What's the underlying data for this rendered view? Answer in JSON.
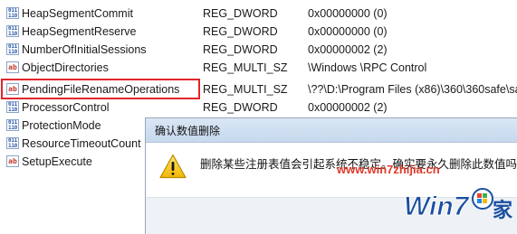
{
  "registry": {
    "rows": [
      {
        "icon": "binary-value-icon",
        "name": "HeapSegmentCommit",
        "type": "REG_DWORD",
        "data": "0x00000000 (0)"
      },
      {
        "icon": "binary-value-icon",
        "name": "HeapSegmentReserve",
        "type": "REG_DWORD",
        "data": "0x00000000 (0)"
      },
      {
        "icon": "binary-value-icon",
        "name": "NumberOfInitialSessions",
        "type": "REG_DWORD",
        "data": "0x00000002 (2)"
      },
      {
        "icon": "string-value-icon",
        "name": "ObjectDirectories",
        "type": "REG_MULTI_SZ",
        "data": "\\Windows \\RPC Control"
      },
      {
        "icon": "string-value-icon",
        "name": "PendingFileRenameOperations",
        "type": "REG_MULTI_SZ",
        "data": "\\??\\D:\\Program Files (x86)\\360\\360safe\\sa"
      },
      {
        "icon": "binary-value-icon",
        "name": "ProcessorControl",
        "type": "REG_DWORD",
        "data": "0x00000002 (2)"
      },
      {
        "icon": "binary-value-icon",
        "name": "ProtectionMode",
        "type": "",
        "data": ""
      },
      {
        "icon": "binary-value-icon",
        "name": "ResourceTimeoutCount",
        "type": "",
        "data": ""
      },
      {
        "icon": "string-value-icon",
        "name": "SetupExecute",
        "type": "",
        "data": ""
      }
    ],
    "icon_glyphs": {
      "string": "ab",
      "binary": "011\n110"
    },
    "highlight_color": "#e0262b"
  },
  "dialog": {
    "title": "确认数值删除",
    "message": "删除某些注册表值会引起系统不稳定。确实要永久删除此数值吗?",
    "icon": "warning-icon"
  },
  "watermark": {
    "url": "www.win7zhijia.cn",
    "logo_text_a": "Win7",
    "logo_text_b": "家",
    "url_color": "#e03a2b",
    "logo_color": "#1a4fa0"
  }
}
